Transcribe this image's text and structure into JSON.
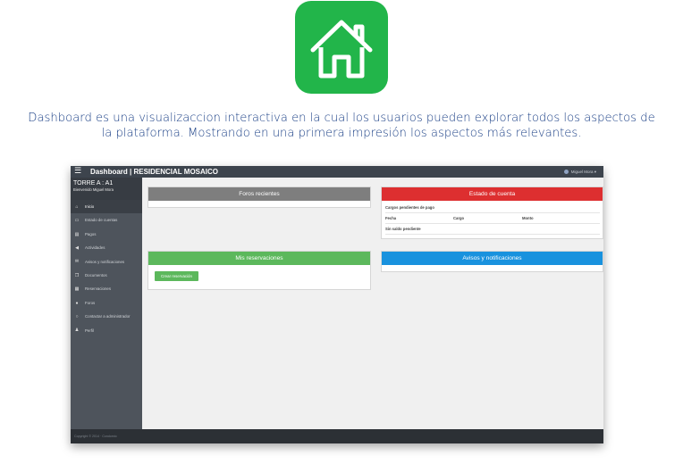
{
  "logo": {
    "icon": "house-icon",
    "color": "#22b54a"
  },
  "intro": {
    "line1": "Dashboard es una visualizaccion interactiva en la cual los usuarios pueden explorar todos los aspectos de",
    "line2": "la plataforma. Mostrando en una primera impresión los aspectos más relevantes."
  },
  "app": {
    "brand": "Dashboard | RESIDENCIAL MOSAICO",
    "user_menu": "Miguel Mora ▾",
    "sidebar": {
      "title": "TORRE A : A1",
      "welcome": "Bienvenido Miguel Mora",
      "items": [
        {
          "label": "Inicio",
          "icon": "home-icon"
        },
        {
          "label": "Estado de cuentas",
          "icon": "money-icon"
        },
        {
          "label": "Pagos",
          "icon": "card-icon"
        },
        {
          "label": "Actividades",
          "icon": "megaphone-icon"
        },
        {
          "label": "Avisos y notificaciones",
          "icon": "envelope-icon"
        },
        {
          "label": "Documentos",
          "icon": "files-icon"
        },
        {
          "label": "Reservaciones",
          "icon": "calendar-icon"
        },
        {
          "label": "Foros",
          "icon": "comments-icon"
        },
        {
          "label": "Contactar a administrador",
          "icon": "chat-icon"
        },
        {
          "label": "Perfil",
          "icon": "user-icon"
        }
      ]
    },
    "panels": {
      "foros": {
        "title": "Foros recientes",
        "color": "#7e7e7e"
      },
      "estado": {
        "title": "Estado de cuenta",
        "color": "#dd2f30",
        "section": "Cargos pendientes de pago",
        "columns": [
          "Fecha",
          "Cargo",
          "Monto"
        ],
        "empty": "Sin saldo pendiente"
      },
      "reservaciones": {
        "title": "Mis reservaciones",
        "color": "#5cb85c",
        "button": "Crear reservación"
      },
      "avisos": {
        "title": "Avisos y notificaciones",
        "color": "#1992de"
      }
    },
    "footer": "Copyright © 2014 · Condomio"
  }
}
